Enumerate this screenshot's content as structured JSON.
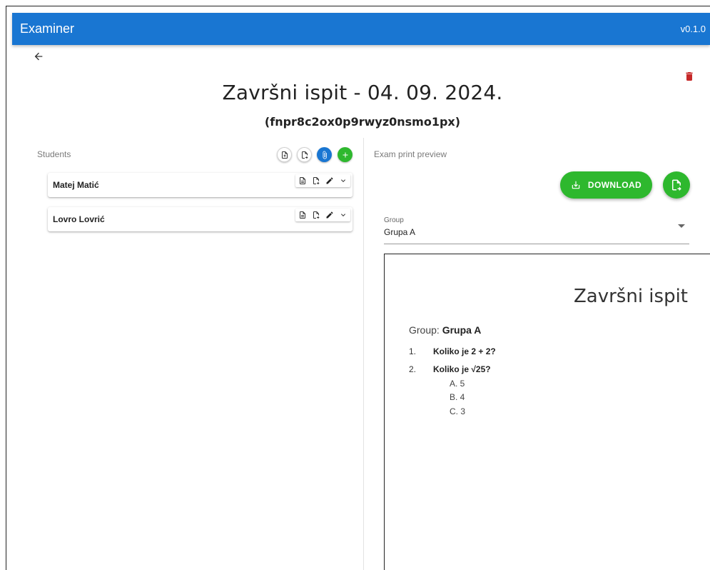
{
  "app": {
    "title": "Examiner",
    "version": "v0.1.0"
  },
  "exam": {
    "title": "Završni ispit - 04. 09. 2024.",
    "id": "(fnpr8c2ox0p9rwyz0nsmo1px)"
  },
  "students": {
    "label": "Students",
    "items": [
      {
        "name": "Matej Matić"
      },
      {
        "name": "Lovro Lovrić"
      }
    ]
  },
  "preview": {
    "label": "Exam print preview",
    "download_label": "DOWNLOAD",
    "group_field_label": "Group",
    "group_value": "Grupa A",
    "paper": {
      "title": "Završni ispit",
      "group_prefix": "Group:",
      "group_name": "Grupa A",
      "questions": [
        {
          "num": "1.",
          "text": "Koliko je 2 + 2?"
        },
        {
          "num": "2.",
          "text": "Koliko je √25?",
          "options": [
            "A. 5",
            "B. 4",
            "C. 3"
          ]
        }
      ]
    }
  },
  "colors": {
    "primary": "#1976d2",
    "success": "#2eb82e",
    "danger": "#c62828"
  },
  "icons": {
    "back": "arrow-left-icon",
    "delete": "trash-icon",
    "student_actions": [
      "document-icon",
      "document-export-icon",
      "pencil-icon",
      "chevron-down-icon"
    ],
    "header_actions": [
      "document-add-icon",
      "document-export-icon",
      "paperclip-icon",
      "plus-icon"
    ]
  }
}
